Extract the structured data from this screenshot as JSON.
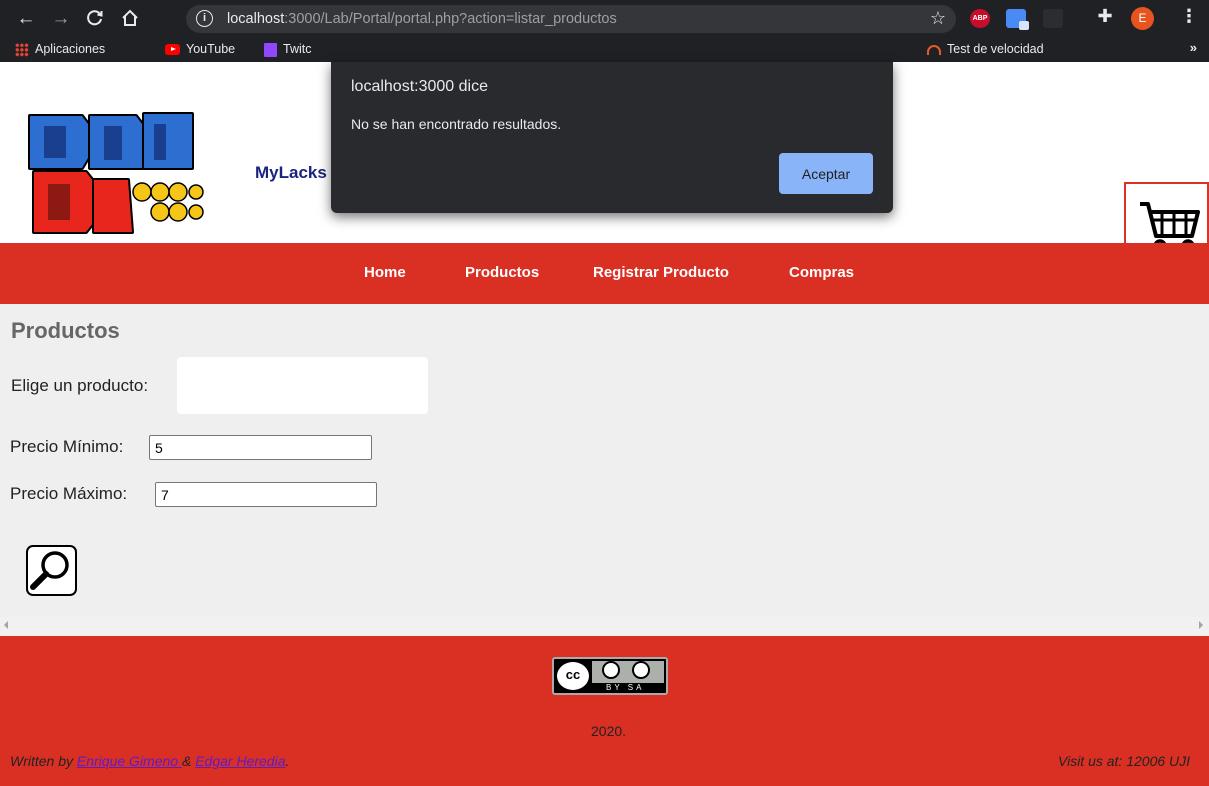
{
  "browser": {
    "url_host": "localhost",
    "url_rest": ":3000/Lab/Portal/portal.php?action=listar_productos",
    "profile_initial": "E",
    "abp_label": "ABP",
    "bookmarks": [
      {
        "label": "Aplicaciones"
      },
      {
        "label": "YouTube"
      },
      {
        "label": "Twitc"
      },
      {
        "label": "Test de velocidad"
      }
    ]
  },
  "header": {
    "site_name": "MyLacks"
  },
  "nav": {
    "items": [
      "Home",
      "Productos",
      "Registrar Producto",
      "Compras"
    ]
  },
  "content": {
    "title": "Productos",
    "product_label": "Elige un producto:",
    "min_label": "Precio Mínimo:",
    "min_value": "5",
    "max_label": "Precio Máximo:",
    "max_value": "7"
  },
  "footer": {
    "license_text": "BY  SA",
    "cc_text": "cc",
    "year": "2020.",
    "written_prefix": "Written by",
    "author1": "Enrique Gimeno ",
    "ampersand": "&",
    "author2": "Edgar Heredia",
    "suffix": ".",
    "visit": "Visit us at: 12006 UJI"
  },
  "dialog": {
    "title": "localhost:3000 dice",
    "message": "No se han encontrado resultados.",
    "button": "Aceptar"
  },
  "colors": {
    "accent_red": "#da3024",
    "dialog_button": "#8ab4f8"
  }
}
